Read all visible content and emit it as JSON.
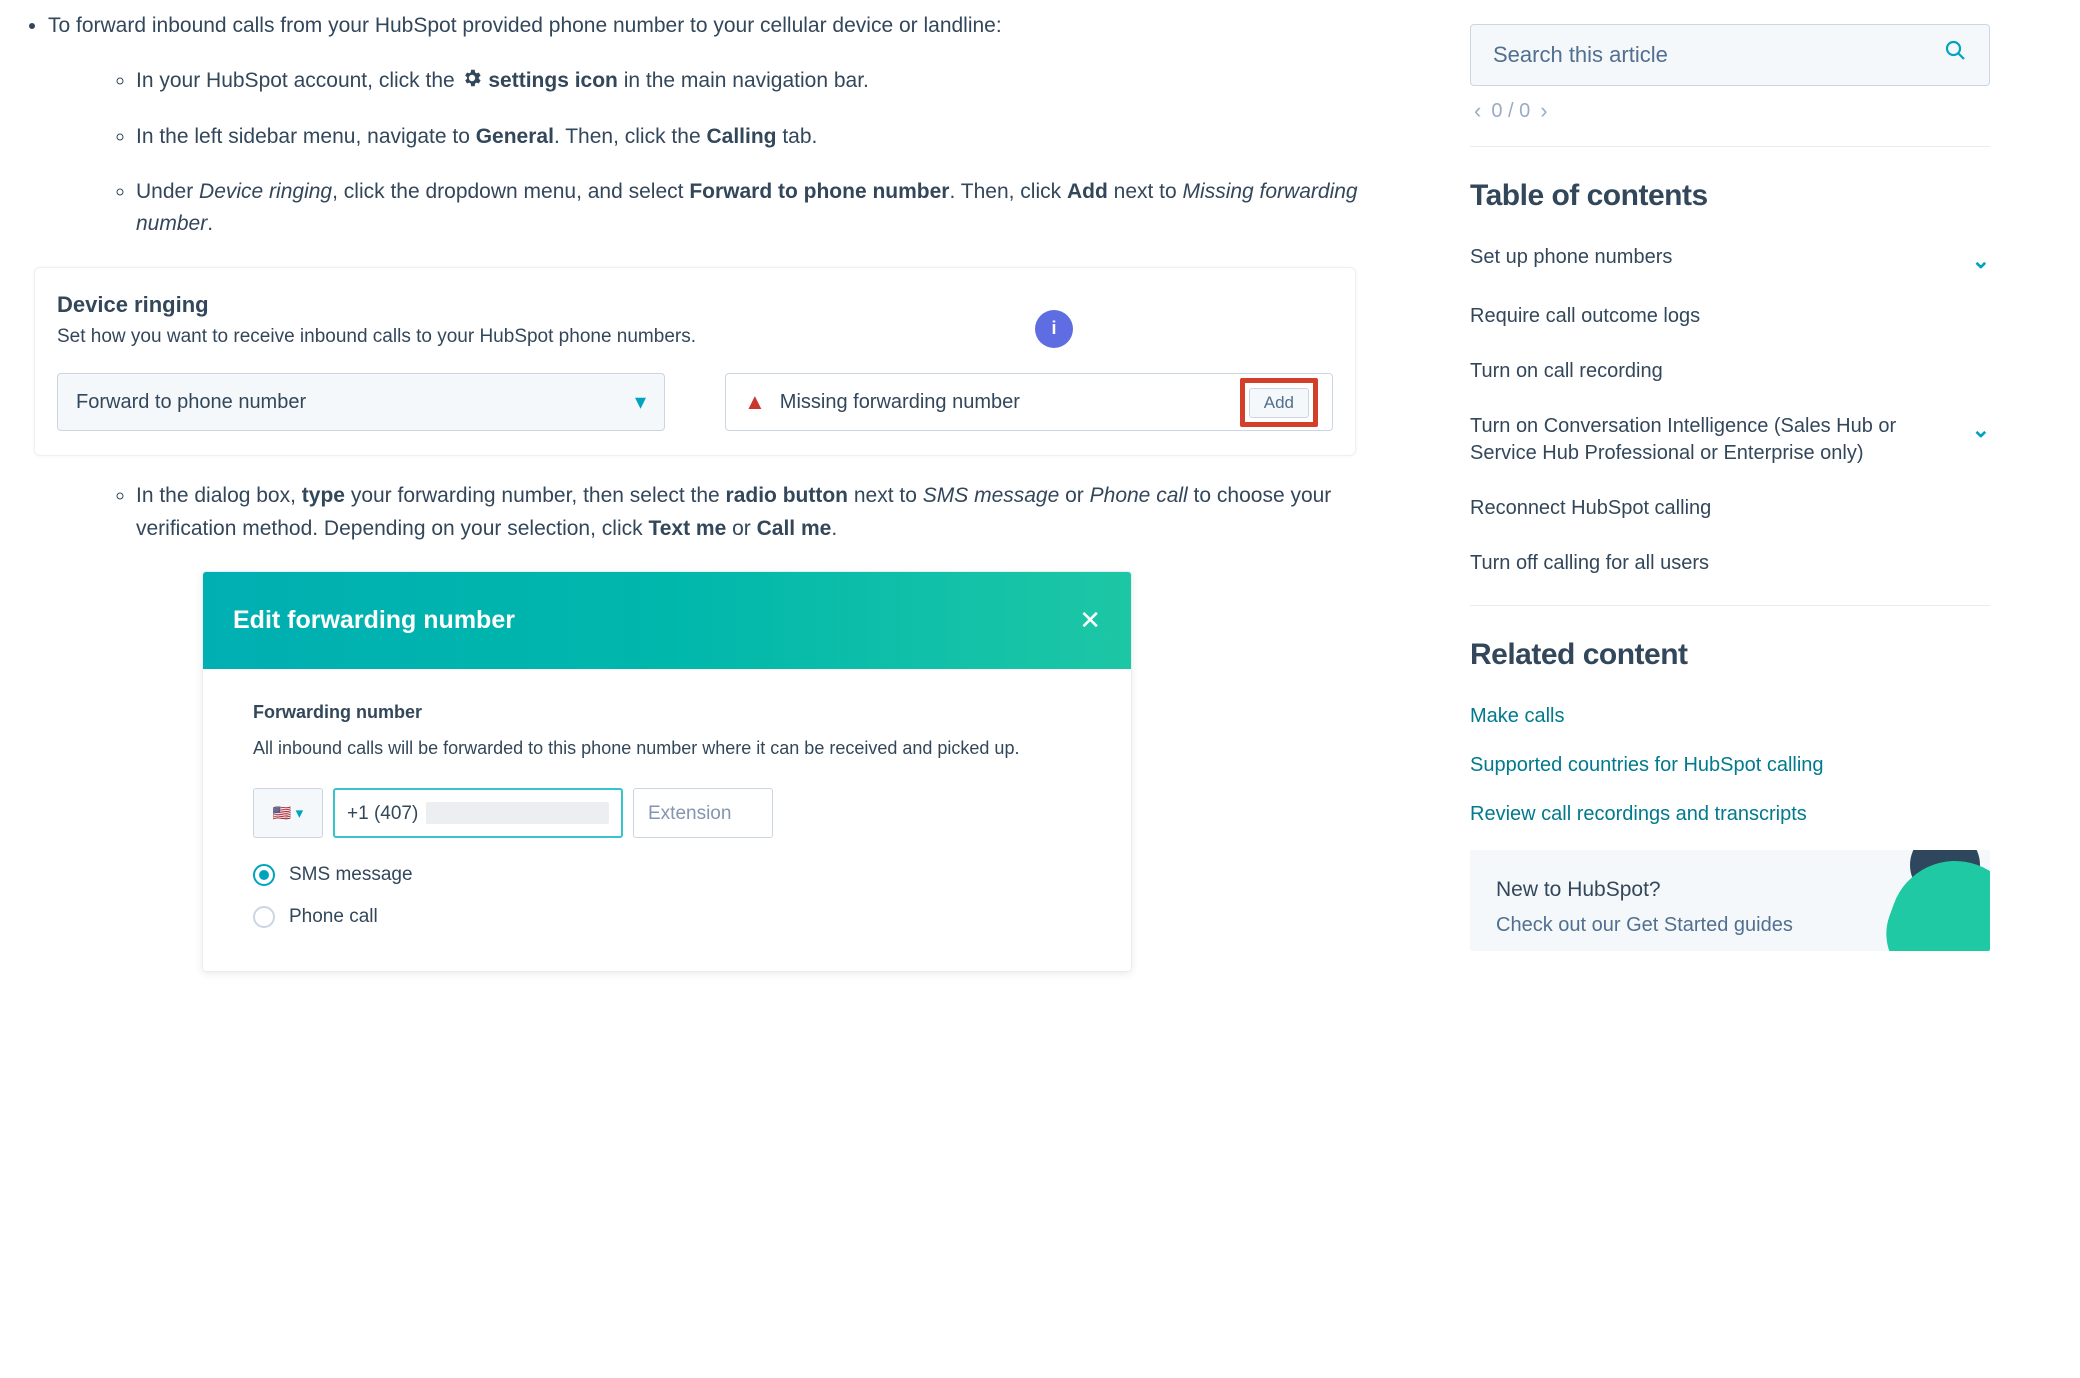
{
  "article": {
    "b1": "To forward inbound calls from your HubSpot provided phone number to your cellular device or landline:",
    "s1a": "In your HubSpot account, click the ",
    "s1b": "settings icon",
    "s1c": " in the main navigation bar.",
    "s2a": "In the left sidebar menu, navigate to ",
    "s2b": "General",
    "s2c": ". Then, click the ",
    "s2d": "Calling",
    "s2e": " tab.",
    "s3a": "Under ",
    "s3b": "Device ringing",
    "s3c": ", click the dropdown menu, and select ",
    "s3d": "Forward to phone number",
    "s3e": ". Then, click ",
    "s3f": "Add",
    "s3g": " next to ",
    "s3h": "Missing forwarding number",
    "s3i": ".",
    "s4a": "In the dialog box, ",
    "s4b": "type",
    "s4c": " your forwarding number, then select the  ",
    "s4d": "radio button",
    "s4e": " next to ",
    "s4f": "SMS message",
    "s4g": " or ",
    "s4h": "Phone call",
    "s4i": " to choose your verification method. Depending on your selection, click ",
    "s4j": "Text me",
    "s4k": " or ",
    "s4l": "Call me",
    "s4m": "."
  },
  "card": {
    "title": "Device ringing",
    "subtitle": "Set how you want to receive inbound calls to your HubSpot phone numbers.",
    "info": "i",
    "select_value": "Forward to phone number",
    "warn_text": "Missing forwarding number",
    "add_label": "Add"
  },
  "modal": {
    "title": "Edit forwarding number",
    "close": "✕",
    "section": "Forwarding number",
    "desc": "All inbound calls will be forwarded to this phone number where it can be received and picked up.",
    "flag": "🇺🇸",
    "flag_caret": "▾",
    "phone_value": "+1 (407)",
    "ext_placeholder": "Extension",
    "radio1": "SMS message",
    "radio2": "Phone call"
  },
  "sidebar": {
    "search_placeholder": "Search this article",
    "pager": "0 / 0",
    "toc_heading": "Table of contents",
    "toc": [
      {
        "label": "Set up phone numbers",
        "expandable": true
      },
      {
        "label": "Require call outcome logs",
        "expandable": false
      },
      {
        "label": "Turn on call recording",
        "expandable": false
      },
      {
        "label": "Turn on Conversation Intelligence (Sales Hub or Service Hub Professional or Enterprise only)",
        "expandable": true
      },
      {
        "label": "Reconnect HubSpot calling",
        "expandable": false
      },
      {
        "label": "Turn off calling for all users",
        "expandable": false
      }
    ],
    "related_heading": "Related content",
    "related": [
      "Make calls",
      "Supported countries for HubSpot calling",
      "Review call recordings and transcripts"
    ],
    "promo_l1": "New to HubSpot?",
    "promo_l2": "Check out our Get Started guides"
  }
}
